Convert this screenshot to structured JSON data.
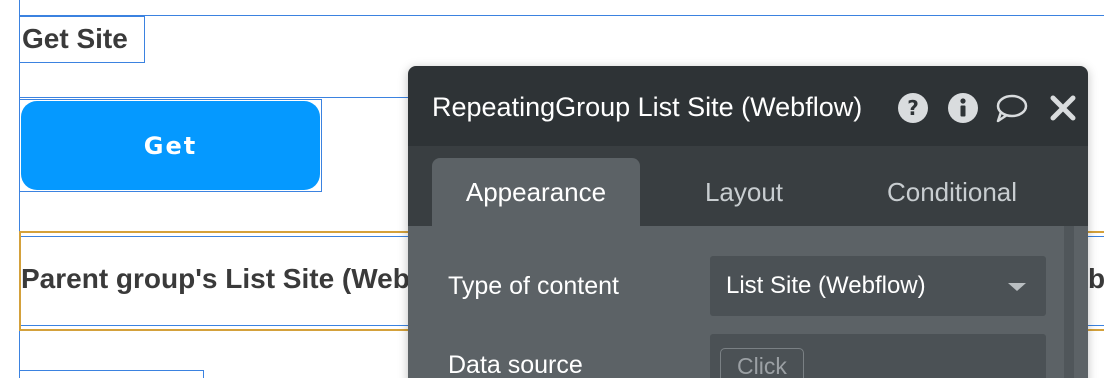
{
  "canvas": {
    "title_text": "Get Site",
    "button_label": "Get",
    "parent_text": "Parent group's List Site (Webflow)'s",
    "right_partial": "b"
  },
  "panel": {
    "title": "RepeatingGroup List Site (Webflow)",
    "icons": [
      "help-icon",
      "info-icon",
      "comment-icon",
      "close-icon"
    ],
    "tabs": [
      {
        "label": "Appearance",
        "active": true
      },
      {
        "label": "Layout",
        "active": false
      },
      {
        "label": "Conditional",
        "active": false
      }
    ],
    "properties": {
      "type_of_content_label": "Type of content",
      "type_of_content_value": "List Site (Webflow)",
      "data_source_label": "Data source",
      "data_source_placeholder": "Click"
    }
  },
  "colors": {
    "accent_blue": "#0599ff",
    "guide_blue": "#3b82e0",
    "group_border": "#d4a13b",
    "panel_header": "#2e3336",
    "panel_body": "#5c6266"
  }
}
